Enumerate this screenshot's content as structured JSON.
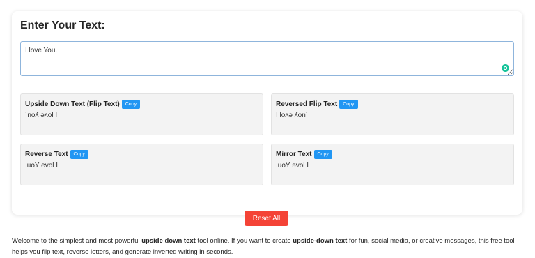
{
  "main": {
    "title": "Enter Your Text:",
    "input_value": "I love You."
  },
  "results": [
    {
      "label": "Upside Down Text (Flip Text)",
      "copy": "Copy",
      "output": "˙noʎ ǝʌol I"
    },
    {
      "label": "Reversed Flip Text",
      "copy": "Copy",
      "output": "I loʌǝ ʎon˙"
    },
    {
      "label": "Reverse Text",
      "copy": "Copy",
      "output": ".uoY evol I"
    },
    {
      "label": "Mirror Text",
      "copy": "Copy",
      "output": ".uoY ɘvol I"
    }
  ],
  "reset_label": "Reset All",
  "description": {
    "p1": "Welcome to the simplest and most powerful ",
    "b1": "upside down text",
    "p2": " tool online. If you want to create ",
    "b2": "upside-down text",
    "p3": " for fun, social media, or creative messages, this free tool helps you flip text, reverse letters, and generate inverted writing in seconds."
  },
  "colors": {
    "copy_button": "#2196f3",
    "reset_button": "#f44336",
    "grammarly_badge": "#15c39a"
  },
  "icons": {
    "input_badge": "grammarly-icon"
  }
}
